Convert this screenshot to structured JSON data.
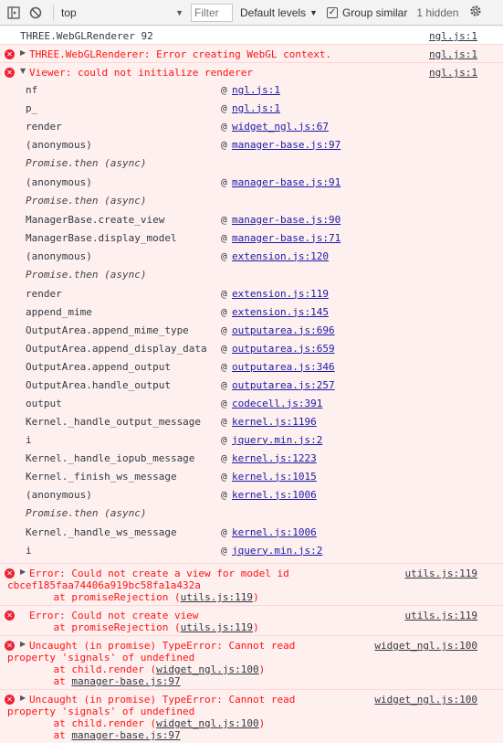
{
  "toolbar": {
    "context": "top",
    "filter_placeholder": "Filter",
    "levels": "Default levels",
    "group_similar": "Group similar",
    "hidden": "1 hidden"
  },
  "log1": {
    "text": "THREE.WebGLRenderer 92",
    "src": "ngl.js:1"
  },
  "err1": {
    "text": "THREE.WebGLRenderer: Error creating WebGL context.",
    "src": "ngl.js:1"
  },
  "err2": {
    "text": "Viewer: could not initialize renderer",
    "src": "ngl.js:1",
    "frames": [
      {
        "name": "nf",
        "loc": "ngl.js:1"
      },
      {
        "name": "p_",
        "loc": "ngl.js:1"
      },
      {
        "name": "render",
        "loc": "widget_ngl.js:67"
      },
      {
        "name": "(anonymous)",
        "loc": "manager-base.js:97"
      },
      {
        "async": "Promise.then (async)"
      },
      {
        "name": "(anonymous)",
        "loc": "manager-base.js:91"
      },
      {
        "async": "Promise.then (async)"
      },
      {
        "name": "ManagerBase.create_view",
        "loc": "manager-base.js:90"
      },
      {
        "name": "ManagerBase.display_model",
        "loc": "manager-base.js:71"
      },
      {
        "name": "(anonymous)",
        "loc": "extension.js:120"
      },
      {
        "async": "Promise.then (async)"
      },
      {
        "name": "render",
        "loc": "extension.js:119"
      },
      {
        "name": "append_mime",
        "loc": "extension.js:145"
      },
      {
        "name": "OutputArea.append_mime_type",
        "loc": "outputarea.js:696"
      },
      {
        "name": "OutputArea.append_display_data",
        "loc": "outputarea.js:659"
      },
      {
        "name": "OutputArea.append_output",
        "loc": "outputarea.js:346"
      },
      {
        "name": "OutputArea.handle_output",
        "loc": "outputarea.js:257"
      },
      {
        "name": "output",
        "loc": "codecell.js:391"
      },
      {
        "name": "Kernel._handle_output_message",
        "loc": "kernel.js:1196"
      },
      {
        "name": "i",
        "loc": "jquery.min.js:2"
      },
      {
        "name": "Kernel._handle_iopub_message",
        "loc": "kernel.js:1223"
      },
      {
        "name": "Kernel._finish_ws_message",
        "loc": "kernel.js:1015"
      },
      {
        "name": "(anonymous)",
        "loc": "kernel.js:1006"
      },
      {
        "async": "Promise.then (async)"
      },
      {
        "name": "Kernel._handle_ws_message",
        "loc": "kernel.js:1006"
      },
      {
        "name": "i",
        "loc": "jquery.min.js:2"
      }
    ]
  },
  "err3": {
    "line1": "Error: Could not create a view for model id",
    "line2": "cbcef185faa74406a919bc58fa1a432a",
    "line3_prefix": "    at promiseRejection (",
    "line3_link": "utils.js:119",
    "line3_suffix": ")",
    "src": "utils.js:119"
  },
  "err4": {
    "line1": "Error: Could not create view",
    "line2_prefix": "    at promiseRejection (",
    "line2_link": "utils.js:119",
    "line2_suffix": ")",
    "src": "utils.js:119"
  },
  "err5": {
    "line1": "Uncaught (in promise) TypeError: Cannot read",
    "line2": "property 'signals' of undefined",
    "line3_prefix": "    at child.render (",
    "line3_link": "widget_ngl.js:100",
    "line3_suffix": ")",
    "line4_prefix": "    at ",
    "line4_link": "manager-base.js:97",
    "src": "widget_ngl.js:100"
  },
  "err6": {
    "line1": "Uncaught (in promise) TypeError: Cannot read",
    "line2": "property 'signals' of undefined",
    "line3_prefix": "    at child.render (",
    "line3_link": "widget_ngl.js:100",
    "line3_suffix": ")",
    "line4_prefix": "    at ",
    "line4_link": "manager-base.js:97",
    "src": "widget_ngl.js:100"
  }
}
